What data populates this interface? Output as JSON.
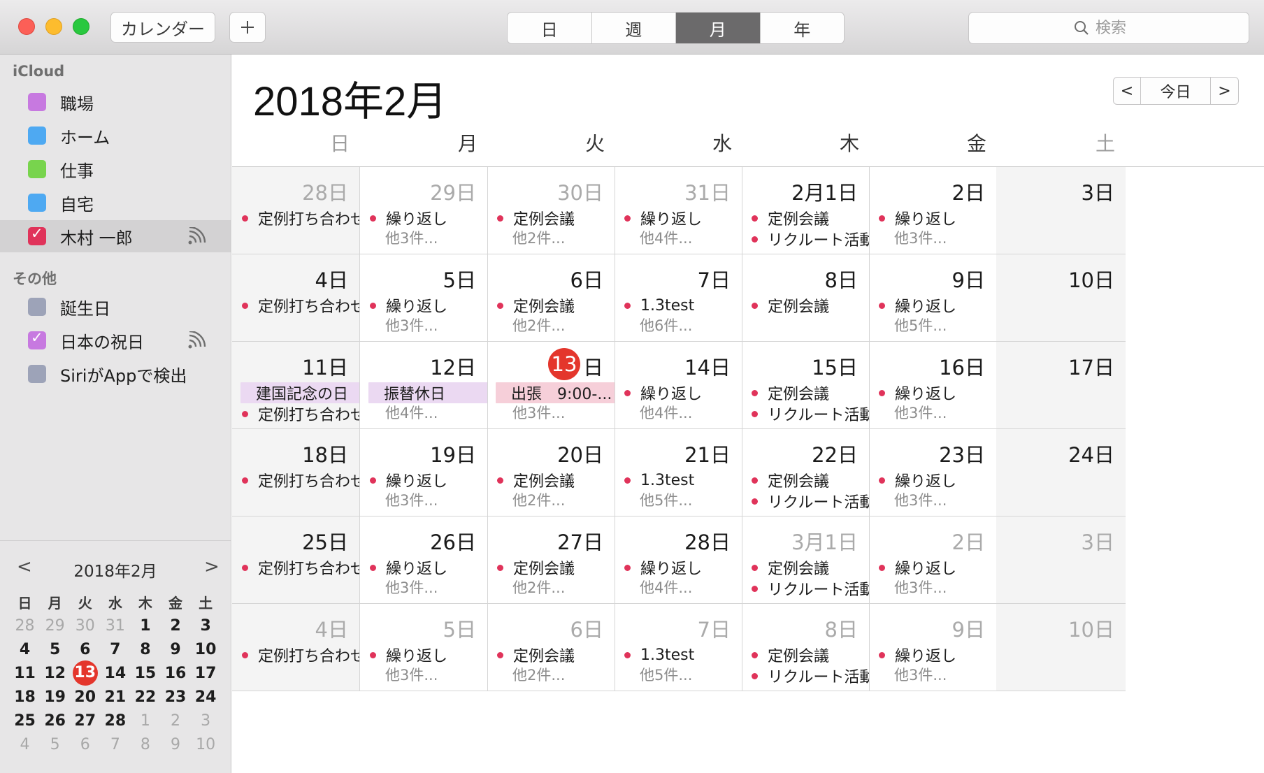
{
  "toolbar": {
    "calendar_button": "カレンダー",
    "add_button": "+",
    "views": [
      "日",
      "週",
      "月",
      "年"
    ],
    "active_view": "月",
    "search_placeholder": "検索"
  },
  "sidebar": {
    "sections": [
      {
        "title": "iCloud",
        "items": [
          {
            "label": "職場",
            "color": "#c779e0",
            "checked": false,
            "shared": false
          },
          {
            "label": "ホーム",
            "color": "#4ea9f2",
            "checked": false,
            "shared": false
          },
          {
            "label": "仕事",
            "color": "#78d44d",
            "checked": false,
            "shared": false
          },
          {
            "label": "自宅",
            "color": "#4ea9f2",
            "checked": false,
            "shared": false
          },
          {
            "label": "木村 一郎",
            "color": "#e0335a",
            "checked": true,
            "shared": true,
            "selected": true
          }
        ]
      },
      {
        "title": "その他",
        "items": [
          {
            "label": "誕生日",
            "color": "#9da3b8",
            "checked": false,
            "shared": false
          },
          {
            "label": "日本の祝日",
            "color": "#c779e0",
            "checked": true,
            "shared": true
          },
          {
            "label": "SiriがAppで検出",
            "color": "#9da3b8",
            "checked": false,
            "shared": false
          }
        ]
      }
    ]
  },
  "mini_calendar": {
    "title": "2018年2月",
    "prev": "<",
    "next": ">",
    "weekdays": [
      "日",
      "月",
      "火",
      "水",
      "木",
      "金",
      "土"
    ],
    "weeks": [
      [
        {
          "d": "28",
          "dim": true
        },
        {
          "d": "29",
          "dim": true
        },
        {
          "d": "30",
          "dim": true
        },
        {
          "d": "31",
          "dim": true
        },
        {
          "d": "1"
        },
        {
          "d": "2"
        },
        {
          "d": "3"
        }
      ],
      [
        {
          "d": "4"
        },
        {
          "d": "5"
        },
        {
          "d": "6"
        },
        {
          "d": "7"
        },
        {
          "d": "8"
        },
        {
          "d": "9"
        },
        {
          "d": "10"
        }
      ],
      [
        {
          "d": "11"
        },
        {
          "d": "12"
        },
        {
          "d": "13",
          "today": true
        },
        {
          "d": "14"
        },
        {
          "d": "15"
        },
        {
          "d": "16"
        },
        {
          "d": "17"
        }
      ],
      [
        {
          "d": "18"
        },
        {
          "d": "19"
        },
        {
          "d": "20"
        },
        {
          "d": "21"
        },
        {
          "d": "22"
        },
        {
          "d": "23"
        },
        {
          "d": "24"
        }
      ],
      [
        {
          "d": "25"
        },
        {
          "d": "26"
        },
        {
          "d": "27"
        },
        {
          "d": "28"
        },
        {
          "d": "1",
          "dim": true
        },
        {
          "d": "2",
          "dim": true
        },
        {
          "d": "3",
          "dim": true
        }
      ],
      [
        {
          "d": "4",
          "dim": true
        },
        {
          "d": "5",
          "dim": true
        },
        {
          "d": "6",
          "dim": true
        },
        {
          "d": "7",
          "dim": true
        },
        {
          "d": "8",
          "dim": true
        },
        {
          "d": "9",
          "dim": true
        },
        {
          "d": "10",
          "dim": true
        }
      ]
    ]
  },
  "main": {
    "title": "2018年2月",
    "nav": {
      "prev": "<",
      "today": "今日",
      "next": ">"
    },
    "weekdays": [
      "日",
      "月",
      "火",
      "水",
      "木",
      "金",
      "土"
    ],
    "weeks": [
      [
        {
          "label": "28日",
          "other": true,
          "events": [
            {
              "t": "定例打ち合わせ"
            }
          ]
        },
        {
          "label": "29日",
          "other": true,
          "events": [
            {
              "t": "繰り返し"
            }
          ],
          "more": "他3件..."
        },
        {
          "label": "30日",
          "other": true,
          "events": [
            {
              "t": "定例会議"
            }
          ],
          "more": "他2件..."
        },
        {
          "label": "31日",
          "other": true,
          "events": [
            {
              "t": "繰り返し"
            }
          ],
          "more": "他4件..."
        },
        {
          "label": "2月1日",
          "events": [
            {
              "t": "定例会議"
            },
            {
              "t": "リクルート活動"
            }
          ]
        },
        {
          "label": "2日",
          "events": [
            {
              "t": "繰り返し"
            }
          ],
          "more": "他3件..."
        },
        {
          "label": "3日",
          "events": []
        }
      ],
      [
        {
          "label": "4日",
          "events": [
            {
              "t": "定例打ち合わせ"
            }
          ]
        },
        {
          "label": "5日",
          "events": [
            {
              "t": "繰り返し"
            }
          ],
          "more": "他3件..."
        },
        {
          "label": "6日",
          "events": [
            {
              "t": "定例会議"
            }
          ],
          "more": "他2件..."
        },
        {
          "label": "7日",
          "events": [
            {
              "t": "1.3test"
            }
          ],
          "more": "他6件..."
        },
        {
          "label": "8日",
          "events": [
            {
              "t": "定例会議"
            }
          ]
        },
        {
          "label": "9日",
          "events": [
            {
              "t": "繰り返し"
            }
          ],
          "more": "他5件..."
        },
        {
          "label": "10日",
          "events": []
        }
      ],
      [
        {
          "label": "11日",
          "events": [
            {
              "t": "建国記念の日",
              "band": "purple"
            },
            {
              "t": "定例打ち合わせ"
            }
          ]
        },
        {
          "label": "12日",
          "events": [
            {
              "t": "振替休日",
              "band": "purple"
            }
          ],
          "more": "他4件..."
        },
        {
          "label": "日",
          "today": "13",
          "events": [
            {
              "t": "出張　9:00-...",
              "band": "pink"
            }
          ],
          "more": "他3件..."
        },
        {
          "label": "14日",
          "events": [
            {
              "t": "繰り返し"
            }
          ],
          "more": "他4件..."
        },
        {
          "label": "15日",
          "events": [
            {
              "t": "定例会議"
            },
            {
              "t": "リクルート活動"
            }
          ]
        },
        {
          "label": "16日",
          "events": [
            {
              "t": "繰り返し"
            }
          ],
          "more": "他3件..."
        },
        {
          "label": "17日",
          "events": []
        }
      ],
      [
        {
          "label": "18日",
          "events": [
            {
              "t": "定例打ち合わせ"
            }
          ]
        },
        {
          "label": "19日",
          "events": [
            {
              "t": "繰り返し"
            }
          ],
          "more": "他3件..."
        },
        {
          "label": "20日",
          "events": [
            {
              "t": "定例会議"
            }
          ],
          "more": "他2件..."
        },
        {
          "label": "21日",
          "events": [
            {
              "t": "1.3test"
            }
          ],
          "more": "他5件..."
        },
        {
          "label": "22日",
          "events": [
            {
              "t": "定例会議"
            },
            {
              "t": "リクルート活動"
            }
          ]
        },
        {
          "label": "23日",
          "events": [
            {
              "t": "繰り返し"
            }
          ],
          "more": "他3件..."
        },
        {
          "label": "24日",
          "events": []
        }
      ],
      [
        {
          "label": "25日",
          "events": [
            {
              "t": "定例打ち合わせ"
            }
          ]
        },
        {
          "label": "26日",
          "events": [
            {
              "t": "繰り返し"
            }
          ],
          "more": "他3件..."
        },
        {
          "label": "27日",
          "events": [
            {
              "t": "定例会議"
            }
          ],
          "more": "他2件..."
        },
        {
          "label": "28日",
          "events": [
            {
              "t": "繰り返し"
            }
          ],
          "more": "他4件..."
        },
        {
          "label": "3月1日",
          "other": true,
          "events": [
            {
              "t": "定例会議"
            },
            {
              "t": "リクルート活動"
            }
          ]
        },
        {
          "label": "2日",
          "other": true,
          "events": [
            {
              "t": "繰り返し"
            }
          ],
          "more": "他3件..."
        },
        {
          "label": "3日",
          "other": true,
          "events": []
        }
      ],
      [
        {
          "label": "4日",
          "other": true,
          "events": [
            {
              "t": "定例打ち合わせ"
            }
          ]
        },
        {
          "label": "5日",
          "other": true,
          "events": [
            {
              "t": "繰り返し"
            }
          ],
          "more": "他3件..."
        },
        {
          "label": "6日",
          "other": true,
          "events": [
            {
              "t": "定例会議"
            }
          ],
          "more": "他2件..."
        },
        {
          "label": "7日",
          "other": true,
          "events": [
            {
              "t": "1.3test"
            }
          ],
          "more": "他5件..."
        },
        {
          "label": "8日",
          "other": true,
          "events": [
            {
              "t": "定例会議"
            },
            {
              "t": "リクルート活動"
            }
          ]
        },
        {
          "label": "9日",
          "other": true,
          "events": [
            {
              "t": "繰り返し"
            }
          ],
          "more": "他3件..."
        },
        {
          "label": "10日",
          "other": true,
          "events": []
        }
      ]
    ]
  },
  "colors": {
    "today": "#e4362c",
    "event_dot": "#e0335a",
    "holiday_band": "#ebd9f2",
    "trip_band": "#f6cfd9"
  }
}
